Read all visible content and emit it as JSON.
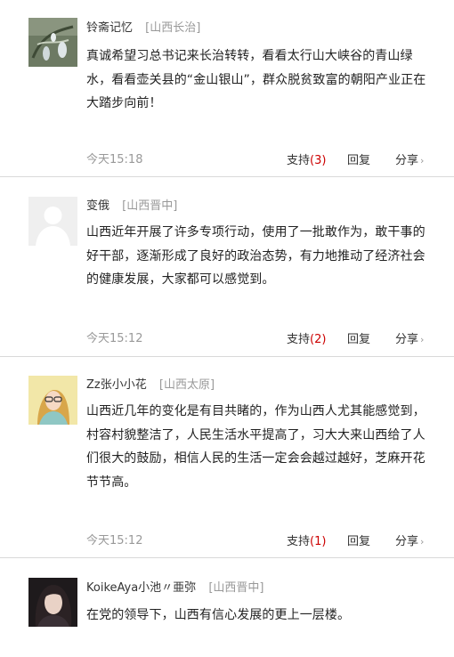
{
  "actions": {
    "support": "支持",
    "reply": "回复",
    "share": "分享"
  },
  "comments": [
    {
      "user": "铃斋记忆",
      "location": "[山西长治]",
      "text": "真诚希望习总书记来长治转转，看看太行山大峡谷的青山绿水，看看壶关县的“金山银山”，群众脱贫致富的朝阳产业正在大踏步向前！",
      "time": "今天15:18",
      "support_count": "(3)"
    },
    {
      "user": "变俄",
      "location": "[山西晋中]",
      "text": "山西近年开展了许多专项行动，使用了一批敢作为，敢干事的好干部，逐渐形成了良好的政治态势，有力地推动了经济社会的健康发展，大家都可以感觉到。",
      "time": "今天15:12",
      "support_count": "(2)"
    },
    {
      "user": "Zz张小小花",
      "location": "[山西太原]",
      "text": "山西近几年的变化是有目共睹的，作为山西人尤其能感觉到，村容村貌整洁了，人民生活水平提高了，习大大来山西给了人们很大的鼓励，相信人民的生活一定会会越过越好，芝麻开花节节高。",
      "time": "今天15:12",
      "support_count": "(1)"
    },
    {
      "user": "KoikeAya小池〃亜弥",
      "location": "[山西晋中]",
      "text": "在党的领导下，山西有信心发展的更上一层楼。"
    }
  ]
}
